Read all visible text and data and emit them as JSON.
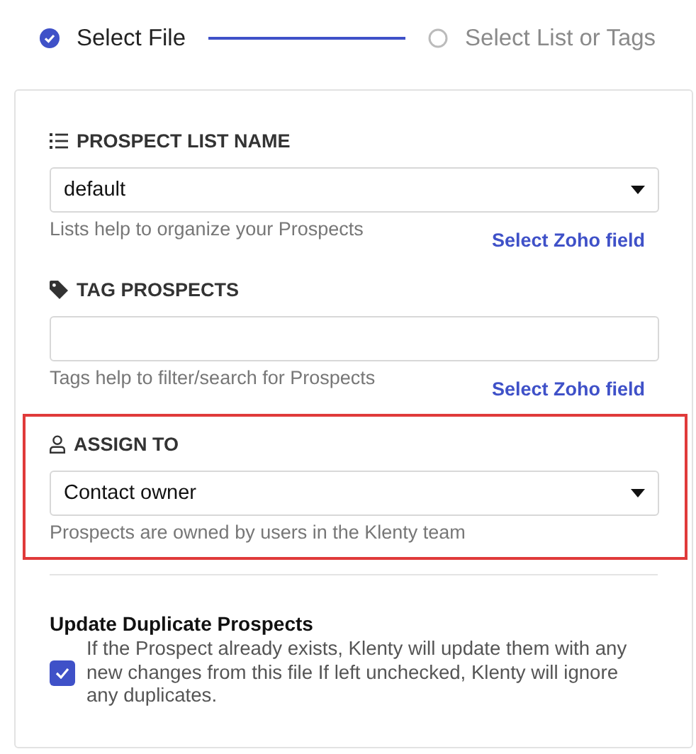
{
  "steps": [
    {
      "label": "Select File",
      "done": true
    },
    {
      "label": "Select List or Tags",
      "done": false
    }
  ],
  "sections": [
    {
      "label": "PROSPECT LIST NAME",
      "kind": "select",
      "value": "default",
      "hint": "Lists help to organize your Prospects",
      "link": "Select Zoho field",
      "highlighted": false
    },
    {
      "label": "TAG PROSPECTS",
      "kind": "text",
      "hint": "Tags help to filter/search for Prospects",
      "link": "Select Zoho field",
      "highlighted": false
    },
    {
      "label": "ASSIGN TO",
      "kind": "select",
      "value": "Contact owner",
      "hint": "Prospects are owned by users in the Klenty team",
      "highlighted": true
    }
  ],
  "duplicates": {
    "title": "Update Duplicate Prospects",
    "text": "If the Prospect already exists, Klenty will update them with any new changes from this file If left unchecked, Klenty will ignore any duplicates.",
    "checked": true
  }
}
